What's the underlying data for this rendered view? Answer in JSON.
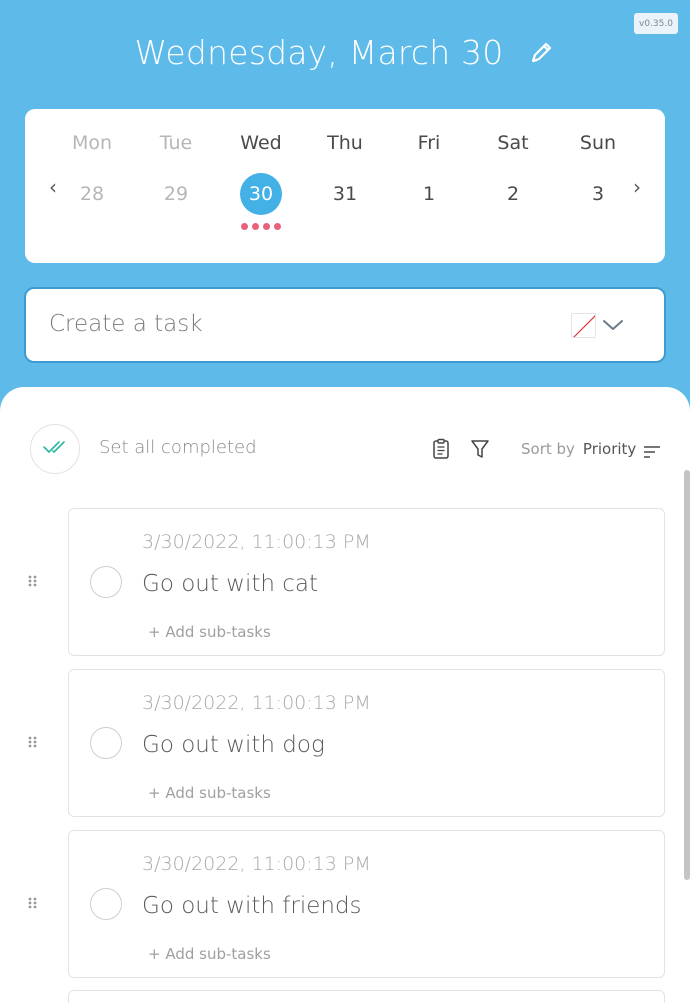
{
  "app": {
    "version": "v0.35.0"
  },
  "header": {
    "title": "Wednesday, March 30"
  },
  "calendar": {
    "days": [
      {
        "name": "Mon",
        "num": "28"
      },
      {
        "name": "Tue",
        "num": "29"
      },
      {
        "name": "Wed",
        "num": "30"
      },
      {
        "name": "Thu",
        "num": "31"
      },
      {
        "name": "Fri",
        "num": "1"
      },
      {
        "name": "Sat",
        "num": "2"
      },
      {
        "name": "Sun",
        "num": "3"
      }
    ],
    "prev_label": "‹",
    "next_label": "›"
  },
  "create": {
    "placeholder": "Create a task"
  },
  "toolbar": {
    "set_all_label": "Set all completed",
    "sort_by_label": "Sort by",
    "sort_value": "Priority"
  },
  "tasks": [
    {
      "date": "3/30/2022, 11:00:13 PM",
      "name": "Go out with cat",
      "sub": "+ Add sub-tasks"
    },
    {
      "date": "3/30/2022, 11:00:13 PM",
      "name": "Go out with dog",
      "sub": "+ Add sub-tasks"
    },
    {
      "date": "3/30/2022, 11:00:13 PM",
      "name": "Go out with friends",
      "sub": "+ Add sub-tasks"
    }
  ],
  "colors": {
    "background": "#5ebbe9",
    "accent": "#43b0e6",
    "dot": "#e8617a"
  }
}
